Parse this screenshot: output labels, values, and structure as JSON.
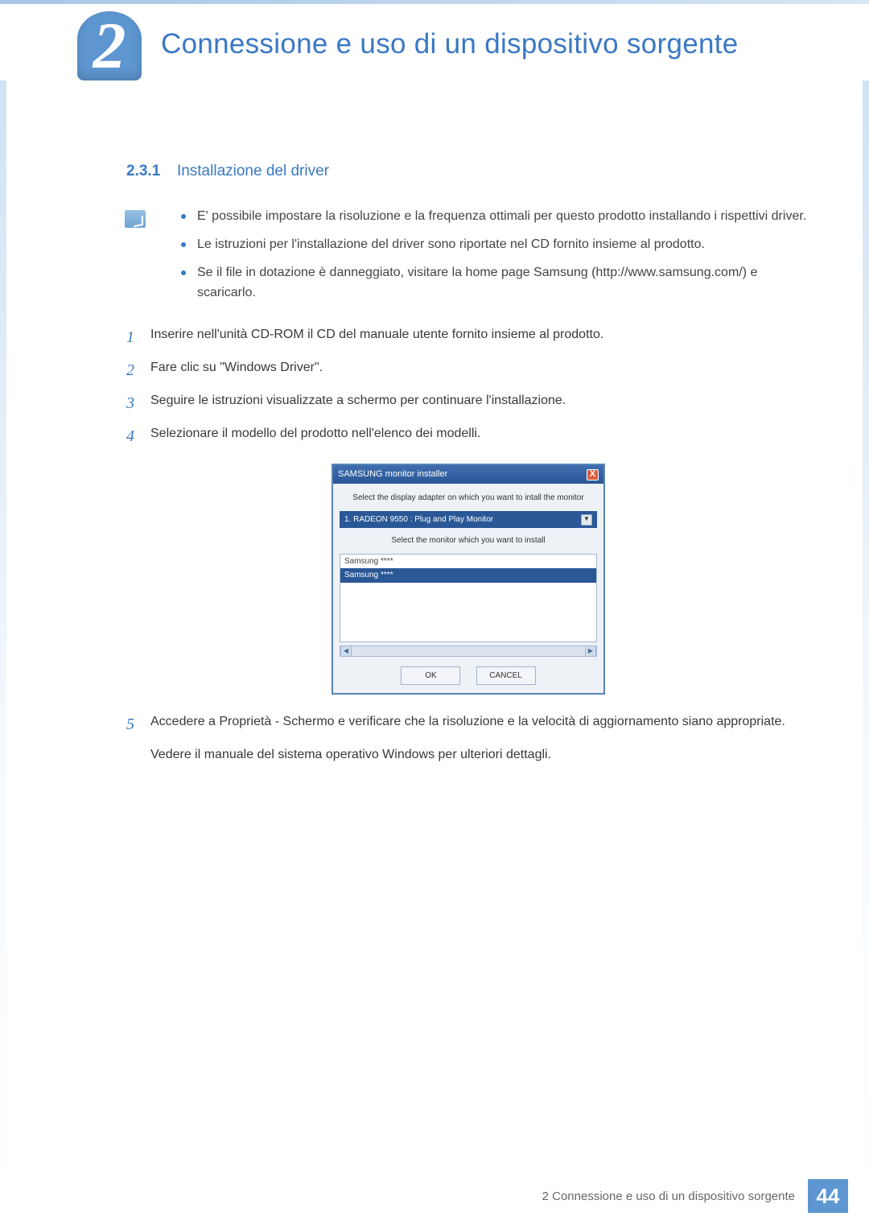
{
  "chapter": {
    "number": "2",
    "title": "Connessione e uso di un dispositivo sorgente"
  },
  "section": {
    "number": "2.3.1",
    "title": "Installazione del driver"
  },
  "notes": [
    "E' possibile impostare la risoluzione e la frequenza ottimali per questo prodotto installando i rispettivi driver.",
    "Le istruzioni per l'installazione del driver sono riportate nel CD fornito insieme al prodotto.",
    "Se il file in dotazione è danneggiato, visitare la home page Samsung (http://www.samsung.com/) e scaricarlo."
  ],
  "steps": {
    "s1": {
      "num": "1",
      "text": "Inserire nell'unità CD-ROM il CD del manuale utente fornito insieme al prodotto."
    },
    "s2": {
      "num": "2",
      "text": "Fare clic su \"Windows Driver\"."
    },
    "s3": {
      "num": "3",
      "text": "Seguire le istruzioni visualizzate a schermo per continuare l'installazione."
    },
    "s4": {
      "num": "4",
      "text": "Selezionare il modello del prodotto nell'elenco dei modelli."
    },
    "s5": {
      "num": "5",
      "text": "Accedere a Proprietà - Schermo e verificare che la risoluzione e la velocità di aggiornamento siano appropriate."
    },
    "s5b": "Vedere il manuale del sistema operativo Windows per ulteriori dettagli."
  },
  "installer": {
    "title": "SAMSUNG monitor installer",
    "close": "X",
    "label1": "Select the display adapter on which you want to intall the monitor",
    "select_value": "1. RADEON 9550 : Plug and Play Monitor",
    "label2": "Select the monitor which you want to install",
    "list_item1": "Samsung ****",
    "list_item2": "Samsung ****",
    "ok": "OK",
    "cancel": "CANCEL"
  },
  "footer": {
    "text": "2 Connessione e uso di un dispositivo sorgente",
    "page": "44"
  }
}
